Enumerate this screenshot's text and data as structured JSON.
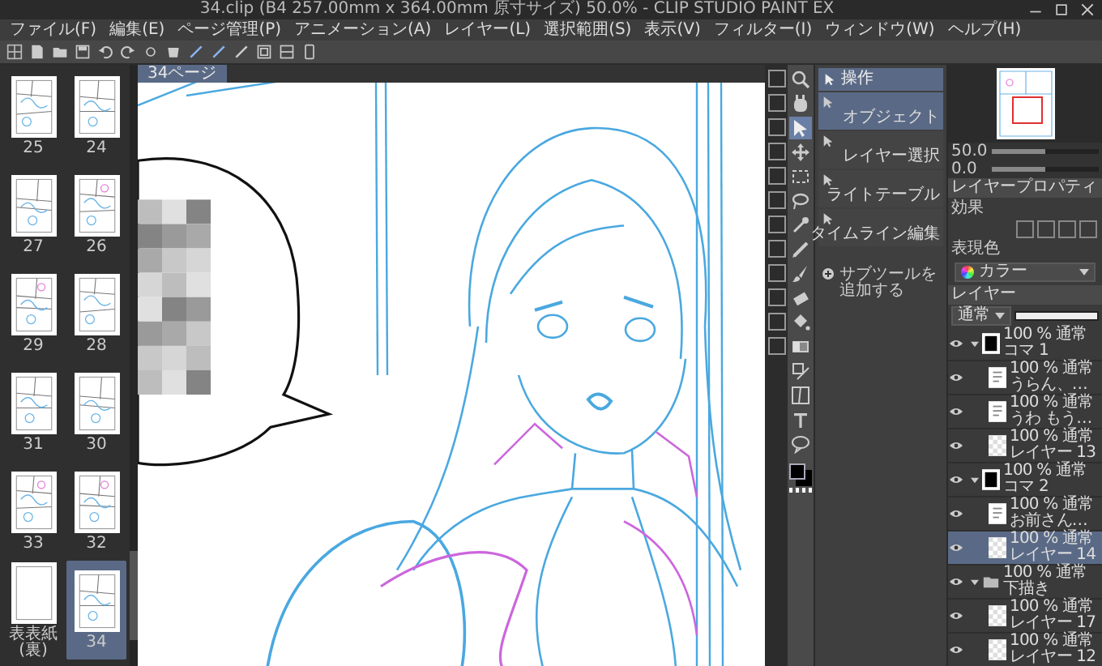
{
  "window": {
    "title": "34.clip (B4 257.00mm x 364.00mm 原寸サイズ) 50.0% - CLIP STUDIO PAINT EX"
  },
  "menu": [
    "ファイル(F)",
    "編集(E)",
    "ページ管理(P)",
    "アニメーション(A)",
    "レイヤー(L)",
    "選択範囲(S)",
    "表示(V)",
    "フィルター(I)",
    "ウィンドウ(W)",
    "ヘルプ(H)"
  ],
  "page_list": {
    "pages": [
      {
        "label": "25",
        "selected": false
      },
      {
        "label": "24",
        "selected": false
      },
      {
        "label": "27",
        "selected": false
      },
      {
        "label": "26",
        "selected": false
      },
      {
        "label": "29",
        "selected": false
      },
      {
        "label": "28",
        "selected": false
      },
      {
        "label": "31",
        "selected": false
      },
      {
        "label": "30",
        "selected": false
      },
      {
        "label": "33",
        "selected": false
      },
      {
        "label": "32",
        "selected": false
      },
      {
        "label": "表表紙(裏)",
        "selected": false
      },
      {
        "label": "34",
        "selected": true
      }
    ]
  },
  "canvas": {
    "tab": "34ページ"
  },
  "tools": [
    {
      "kind": "zoom",
      "selected": false
    },
    {
      "kind": "hand",
      "selected": false
    },
    {
      "kind": "operation",
      "selected": true
    },
    {
      "kind": "move",
      "selected": false
    },
    {
      "kind": "selection",
      "selected": false
    },
    {
      "kind": "lasso",
      "selected": false
    },
    {
      "kind": "eyedropper",
      "selected": false
    },
    {
      "kind": "pen",
      "selected": false
    },
    {
      "kind": "brush",
      "selected": false
    },
    {
      "kind": "eraser",
      "selected": false
    },
    {
      "kind": "fill",
      "selected": false
    },
    {
      "kind": "gradient",
      "selected": false
    },
    {
      "kind": "figure",
      "selected": false
    },
    {
      "kind": "frame",
      "selected": false
    },
    {
      "kind": "text",
      "selected": false
    },
    {
      "kind": "balloon",
      "selected": false
    }
  ],
  "sub_tool": {
    "title": "操作",
    "items": [
      {
        "label": "オブジェクト",
        "selected": true
      },
      {
        "label": "レイヤー選択",
        "selected": false
      },
      {
        "label": "ライトテーブル",
        "selected": false
      },
      {
        "label": "タイムライン編集",
        "selected": false
      }
    ],
    "add_label": "サブツールを追加する"
  },
  "navigator": {
    "sliders": [
      {
        "reading": "50.0",
        "level": 0.5
      },
      {
        "reading": "0.0",
        "level": 0.5
      }
    ]
  },
  "layer_property": {
    "tab": "レイヤープロパティ",
    "effect_label": "効果",
    "color_label": "表現色",
    "color_mode": "カラー"
  },
  "layers_panel": {
    "tab": "レイヤー",
    "blend": "通常",
    "opacity": {
      "level": 1
    },
    "layers": [
      {
        "kind": "frame",
        "mode": "100 % 通常",
        "name": "コマ 1",
        "visible": true,
        "selected": false,
        "expanded": true,
        "children": [
          {
            "kind": "text",
            "mode": "100 % 通常",
            "name": "うらん、…",
            "visible": true,
            "selected": false
          },
          {
            "kind": "text",
            "mode": "100 % 通常",
            "name": "うわ もう…",
            "visible": true,
            "selected": false
          },
          {
            "kind": "raster",
            "mode": "100 % 通常",
            "name": "レイヤー 13",
            "visible": true,
            "selected": false
          }
        ]
      },
      {
        "kind": "frame",
        "mode": "100 % 通常",
        "name": "コマ 2",
        "visible": true,
        "selected": false,
        "expanded": true,
        "children": [
          {
            "kind": "text",
            "mode": "100 % 通常",
            "name": "お前さん…",
            "visible": true,
            "selected": false
          },
          {
            "kind": "raster",
            "mode": "100 % 通常",
            "name": "レイヤー 14",
            "visible": true,
            "selected": true
          }
        ]
      },
      {
        "kind": "folder",
        "mode": "100 % 通常",
        "name": "下描き",
        "visible": true,
        "selected": false,
        "expanded": true,
        "children": [
          {
            "kind": "raster",
            "mode": "100 % 通常",
            "name": "レイヤー 17",
            "visible": true,
            "selected": false
          },
          {
            "kind": "raster",
            "mode": "100 % 通常",
            "name": "レイヤー 12",
            "visible": true,
            "selected": false
          }
        ]
      }
    ]
  }
}
